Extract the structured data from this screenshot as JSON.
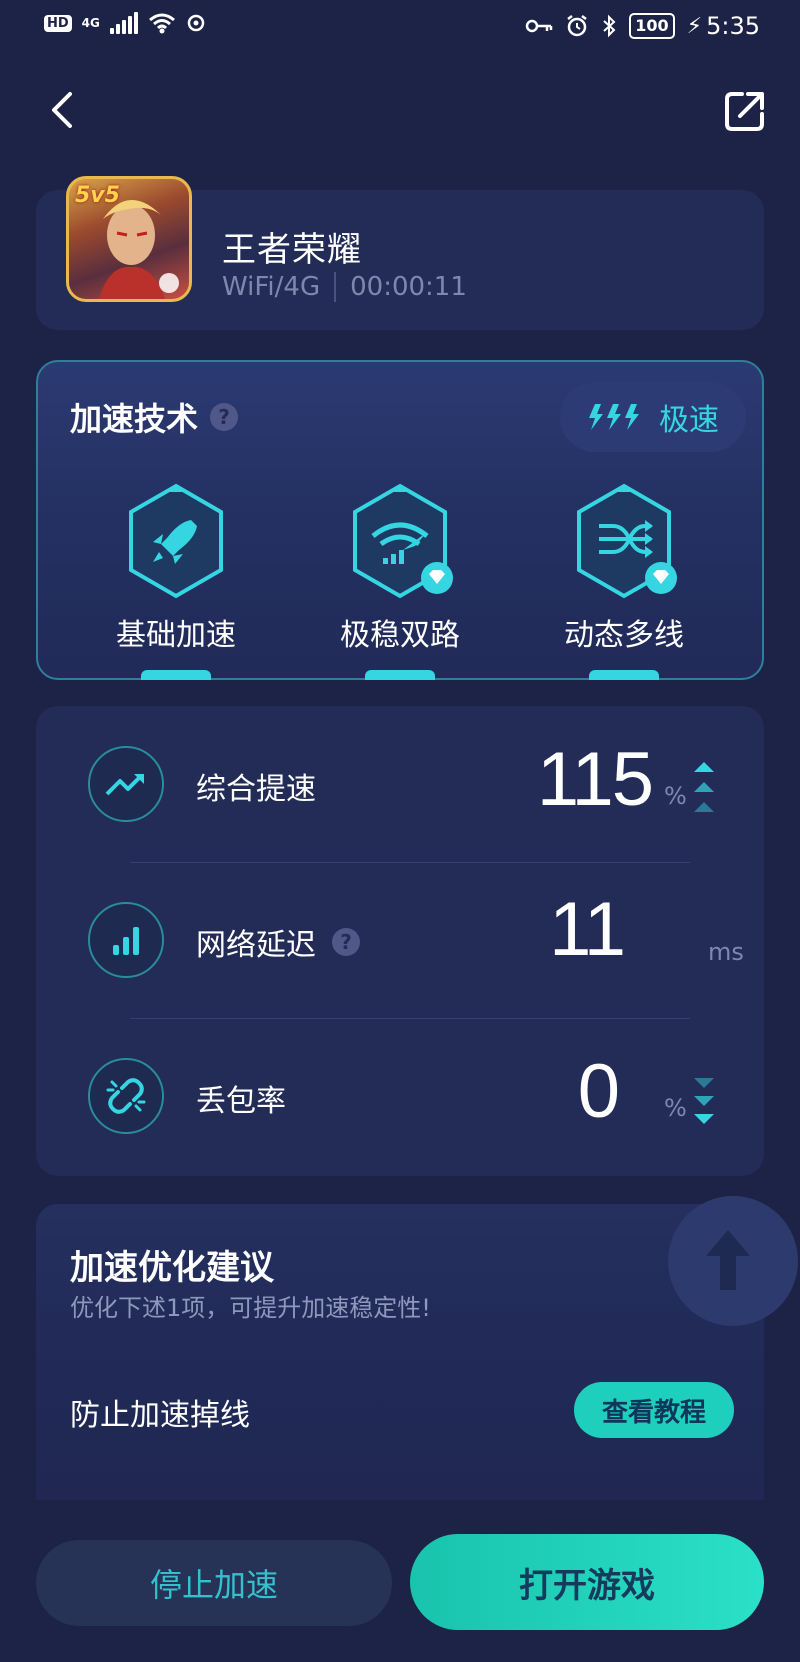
{
  "status_bar": {
    "network_badge": "HD",
    "network_type": "4G",
    "battery": "100",
    "time": "5:35"
  },
  "header": {
    "back_icon": "chevron-left-icon",
    "share_icon": "share-external-icon"
  },
  "game": {
    "name": "王者荣耀",
    "connection": "WiFi/4G",
    "elapsed": "00:00:11",
    "icon_badge": "5v5"
  },
  "tech": {
    "title": "加速技术",
    "mode_label": "极速",
    "items": [
      {
        "label": "基础加速",
        "icon": "rocket-icon",
        "premium": false
      },
      {
        "label": "极稳双路",
        "icon": "wifi-signal-icon",
        "premium": true
      },
      {
        "label": "动态多线",
        "icon": "shuffle-icon",
        "premium": true
      }
    ]
  },
  "stats": [
    {
      "label": "综合提速",
      "value": "115",
      "unit": "%",
      "icon": "trend-up-icon",
      "has_help": false
    },
    {
      "label": "网络延迟",
      "value": "11",
      "unit": "ms",
      "icon": "signal-bars-icon",
      "has_help": true
    },
    {
      "label": "丢包率",
      "value": "0",
      "unit": "%",
      "icon": "broken-link-icon",
      "has_help": false
    }
  ],
  "suggestion": {
    "title": "加速优化建议",
    "subtitle": "优化下述1项，可提升加速稳定性!",
    "item_label": "防止加速掉线",
    "button_label": "查看教程"
  },
  "actions": {
    "stop_label": "停止加速",
    "open_label": "打开游戏"
  },
  "colors": {
    "background": "#1c2346",
    "accent": "#35d6e2",
    "primary_button": "#22d4bc"
  }
}
